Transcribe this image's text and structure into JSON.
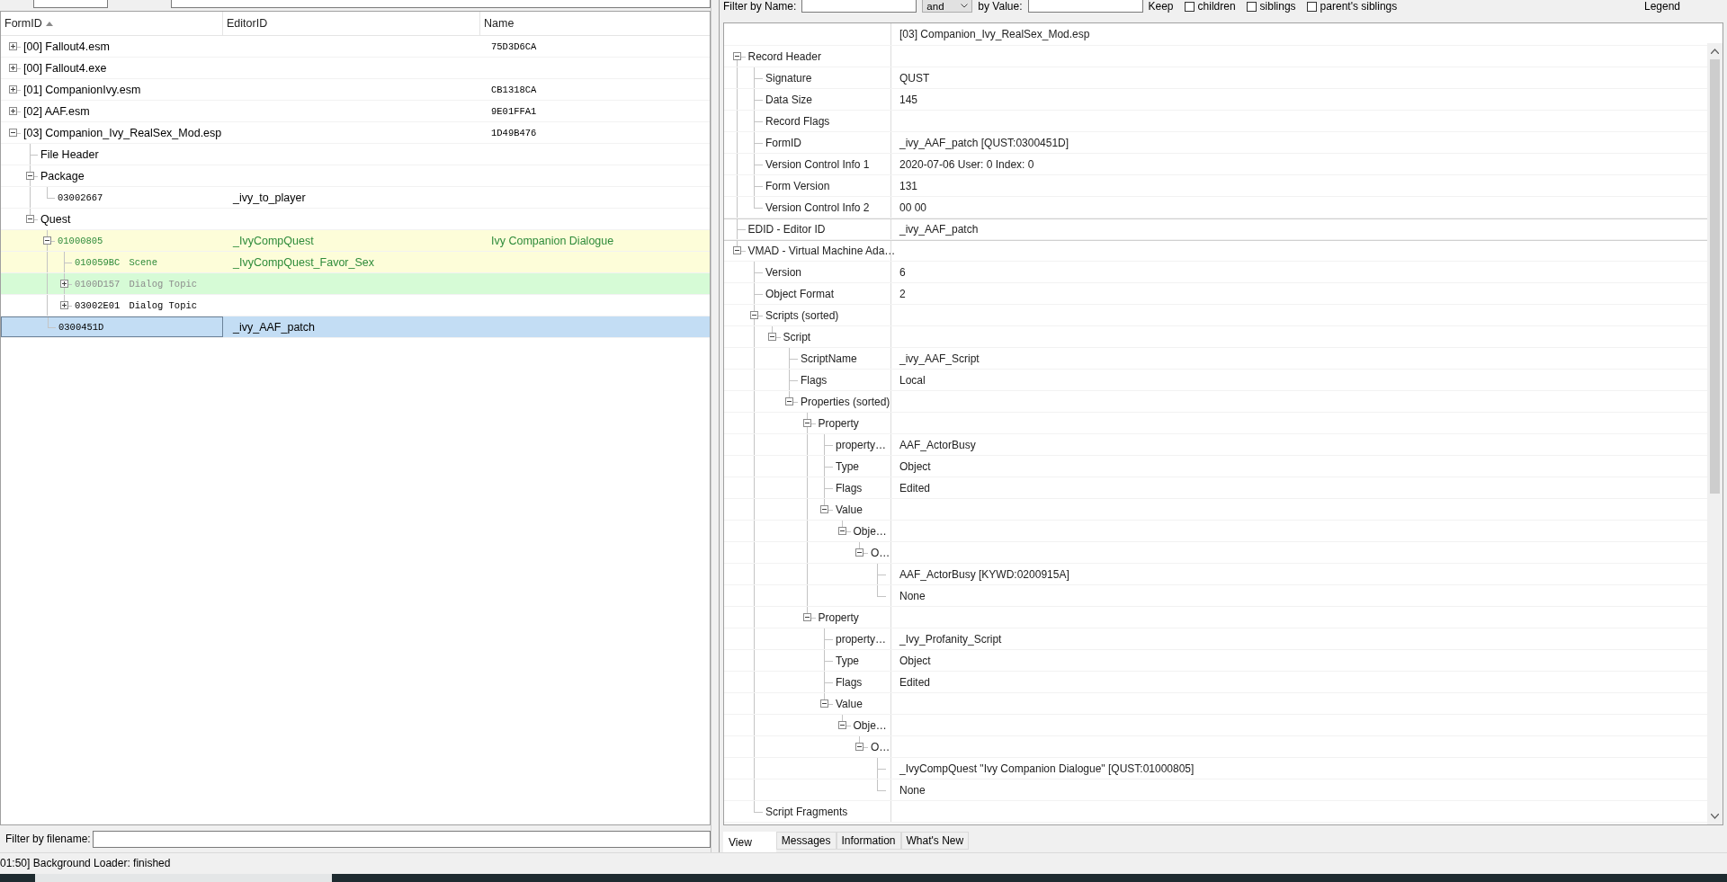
{
  "navigation": {
    "columns": [
      {
        "label": "FormID",
        "sorted": true
      },
      {
        "label": "EditorID"
      },
      {
        "label": "Name"
      }
    ],
    "rows": [
      {
        "kind": "file",
        "form_id": "[00] Fallout4.esm",
        "name": "75D3D6CA",
        "expanded": false,
        "selected": false
      },
      {
        "kind": "file",
        "form_id": "[00] Fallout4.exe",
        "expanded": false,
        "selected": false
      },
      {
        "kind": "file",
        "form_id": "[01] CompanionIvy.esm",
        "name": "CB1318CA",
        "expanded": false,
        "selected": false
      },
      {
        "kind": "file",
        "form_id": "[02] AAF.esm",
        "name": "9E01FFA1",
        "expanded": false,
        "selected": false
      },
      {
        "kind": "file",
        "form_id": "[03] Companion_Ivy_RealSex_Mod.esp",
        "name": "1D49B476",
        "expanded": true,
        "selected": false,
        "children": [
          {
            "kind": "group",
            "form_id": "File Header",
            "selected": false
          },
          {
            "kind": "group",
            "form_id": "Package",
            "expanded": true,
            "selected": false,
            "children": [
              {
                "kind": "record",
                "form_id": "03002667",
                "editor_id": "_ivy_to_player",
                "selected": false
              }
            ]
          },
          {
            "kind": "group",
            "form_id": "Quest",
            "expanded": true,
            "selected": false,
            "children": [
              {
                "kind": "record",
                "form_id": "01000805",
                "editor_id": "_IvyCompQuest",
                "name": "Ivy Companion Dialogue",
                "highlight": {
                  "color": "#fdfdd9"
                },
                "color": "#2e8b3a",
                "expanded": true,
                "selected": false,
                "children": [
                  {
                    "kind": "record",
                    "form_id": "010059BC",
                    "signature": "Scene",
                    "editor_id": "_IvyCompQuest_Favor_Sex",
                    "highlight": {
                      "color": "#fdfdd9"
                    },
                    "color": "#2e8b3a",
                    "selected": false
                  },
                  {
                    "kind": "record",
                    "form_id": "0100D157",
                    "signature": "Dialog Topic",
                    "highlight": {
                      "color": "#d6fbd6"
                    },
                    "color": "#8c8c8c",
                    "expanded": false,
                    "selected": false
                  },
                  {
                    "kind": "record",
                    "form_id": "03002E01",
                    "signature": "Dialog Topic",
                    "expanded": false,
                    "selected": false
                  }
                ]
              },
              {
                "kind": "record",
                "form_id": "0300451D",
                "editor_id": "_ivy_AAF_patch",
                "selected": true
              }
            ]
          }
        ]
      }
    ],
    "filter": {
      "label": "Filter by filename:"
    }
  },
  "record_filter": {
    "name_label": "Filter by Name:",
    "operator": "and",
    "value_label": "by Value:",
    "keep_label": "Keep",
    "options": [
      {
        "label": "children",
        "checked": false
      },
      {
        "label": "siblings",
        "checked": false
      },
      {
        "label": "parent's siblings",
        "checked": false
      }
    ],
    "legend": "Legend"
  },
  "record_view": {
    "file": "[03] Companion_Ivy_RealSex_Mod.esp",
    "rows": [
      {
        "label": "Record Header",
        "expanded": true,
        "children": [
          {
            "label": "Signature",
            "value": "QUST"
          },
          {
            "label": "Data Size",
            "value": "145"
          },
          {
            "label": "Record Flags"
          },
          {
            "label": "FormID",
            "value": "_ivy_AAF_patch [QUST:0300451D]"
          },
          {
            "label": "Version Control Info 1",
            "value": "2020-07-06 User: 0 Index: 0"
          },
          {
            "label": "Form Version",
            "value": "131"
          },
          {
            "label": "Version Control Info 2",
            "value": "00 00"
          }
        ]
      },
      {
        "label": "EDID - Editor ID",
        "value": "_ivy_AAF_patch"
      },
      {
        "label": "VMAD - Virtual Machine Ada…",
        "expanded": true,
        "children": [
          {
            "label": "Version",
            "value": "6"
          },
          {
            "label": "Object Format",
            "value": "2"
          },
          {
            "label": "Scripts (sorted)",
            "expanded": true,
            "children": [
              {
                "label": "Script",
                "expanded": true,
                "children": [
                  {
                    "label": "ScriptName",
                    "value": "_ivy_AAF_Script"
                  },
                  {
                    "label": "Flags",
                    "value": "Local"
                  },
                  {
                    "label": "Properties (sorted)",
                    "expanded": true,
                    "children": [
                      {
                        "label": "Property",
                        "expanded": true,
                        "children": [
                          {
                            "label": "property…",
                            "value": "AAF_ActorBusy"
                          },
                          {
                            "label": "Type",
                            "value": "Object"
                          },
                          {
                            "label": "Flags",
                            "value": "Edited"
                          },
                          {
                            "label": "Value",
                            "expanded": true,
                            "children": [
                              {
                                "label": "Obje…",
                                "expanded": true,
                                "children": [
                                  {
                                    "label": "O…",
                                    "expanded": true,
                                    "children": [
                                      {
                                        "value": "AAF_ActorBusy [KYWD:0200915A]"
                                      },
                                      {
                                        "value": "None"
                                      }
                                    ]
                                  }
                                ]
                              }
                            ]
                          }
                        ]
                      },
                      {
                        "label": "Property",
                        "expanded": true,
                        "children": [
                          {
                            "label": "property…",
                            "value": "_Ivy_Profanity_Script"
                          },
                          {
                            "label": "Type",
                            "value": "Object"
                          },
                          {
                            "label": "Flags",
                            "value": "Edited"
                          },
                          {
                            "label": "Value",
                            "expanded": true,
                            "children": [
                              {
                                "label": "Obje…",
                                "expanded": true,
                                "children": [
                                  {
                                    "label": "O…",
                                    "expanded": true,
                                    "children": [
                                      {
                                        "value": "_IvyCompQuest \"Ivy Companion Dialogue\" [QUST:01000805]"
                                      },
                                      {
                                        "value": "None"
                                      }
                                    ]
                                  }
                                ]
                              }
                            ]
                          }
                        ]
                      }
                    ]
                  }
                ]
              }
            ]
          },
          {
            "label": "Script Fragments"
          }
        ]
      }
    ]
  },
  "tabs": [
    {
      "label": "View",
      "selected": true
    },
    {
      "label": "Messages",
      "selected": false
    },
    {
      "label": "Information",
      "selected": false
    },
    {
      "label": "What's New",
      "selected": false
    }
  ],
  "status_bar": {
    "text": "01:50] Background Loader: finished"
  }
}
